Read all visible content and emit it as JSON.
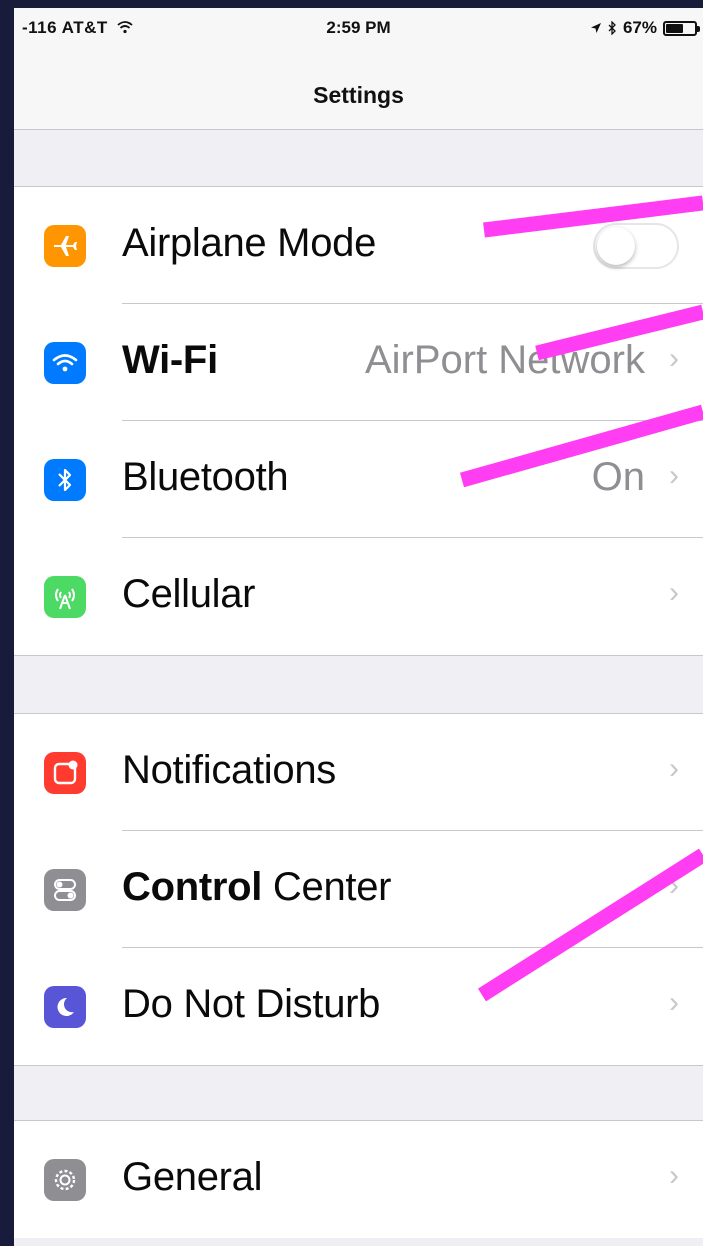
{
  "status_bar": {
    "carrier": "-116 AT&T",
    "time": "2:59 PM",
    "battery": "67%"
  },
  "nav": {
    "title": "Settings"
  },
  "groups": [
    {
      "rows": [
        {
          "label": "Airplane Mode",
          "control": "toggle",
          "toggle_on": false,
          "icon": "airplane-icon",
          "icon_color": "#ff9500"
        },
        {
          "label": "Wi-Fi",
          "value": "AirPort Network",
          "icon": "wifi-icon",
          "icon_color": "#007aff"
        },
        {
          "label": "Bluetooth",
          "value": "On",
          "icon": "bluetooth-icon",
          "icon_color": "#007aff"
        },
        {
          "label": "Cellular",
          "icon": "cellular-icon",
          "icon_color": "#4cd964"
        }
      ]
    },
    {
      "rows": [
        {
          "label": "Notifications",
          "icon": "notifications-icon",
          "icon_color": "#ff3b30"
        },
        {
          "label_bold": "Control",
          "label_rest": " Center",
          "icon": "control-center-icon",
          "icon_color": "#8e8e93"
        },
        {
          "label": "Do Not Disturb",
          "icon": "moon-icon",
          "icon_color": "#5856d6"
        }
      ]
    },
    {
      "rows": [
        {
          "label": "General",
          "icon": "gear-icon",
          "icon_color": "#8e8e93"
        }
      ]
    }
  ],
  "colors": {
    "annotation": "#ff3df2",
    "background": "#efeff4"
  }
}
